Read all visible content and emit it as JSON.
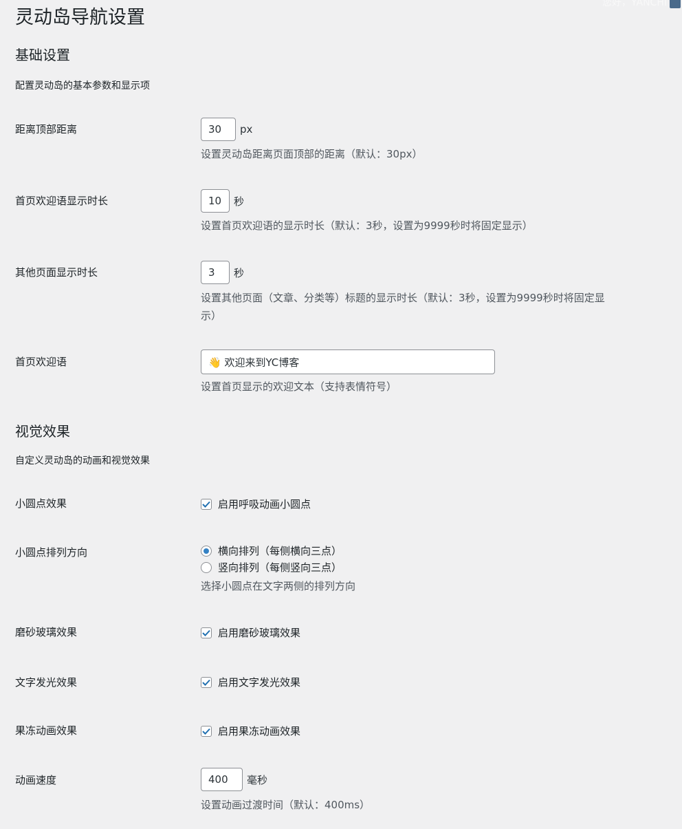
{
  "header": {
    "title": "灵动岛导航设置",
    "greeting": "您好，YANCHI"
  },
  "basic": {
    "heading": "基础设置",
    "description": "配置灵动岛的基本参数和显示项",
    "top_distance": {
      "label": "距离顶部距离",
      "value": "30",
      "unit": "px",
      "help": "设置灵动岛距离页面顶部的距离（默认：30px）"
    },
    "home_duration": {
      "label": "首页欢迎语显示时长",
      "value": "10",
      "unit": "秒",
      "help": "设置首页欢迎语的显示时长（默认：3秒，设置为9999秒时将固定显示）"
    },
    "other_duration": {
      "label": "其他页面显示时长",
      "value": "3",
      "unit": "秒",
      "help_line1": "设置其他页面（文章、分类等）标题的显示时长（默认：3秒，设置为9999秒时将固定显",
      "help_line2": "示）"
    },
    "welcome": {
      "label": "首页欢迎语",
      "value": "👋 欢迎来到YC博客",
      "help": "设置首页显示的欢迎文本（支持表情符号）"
    }
  },
  "visual": {
    "heading": "视觉效果",
    "description": "自定义灵动岛的动画和视觉效果",
    "dots": {
      "label": "小圆点效果",
      "checkbox_label": "启用呼吸动画小圆点",
      "checked": true
    },
    "dots_direction": {
      "label": "小圆点排列方向",
      "options": [
        "横向排列（每侧横向三点）",
        "竖向排列（每侧竖向三点）"
      ],
      "selected": 0,
      "help": "选择小圆点在文字两侧的排列方向"
    },
    "frosted": {
      "label": "磨砂玻璃效果",
      "checkbox_label": "启用磨砂玻璃效果",
      "checked": true
    },
    "glow": {
      "label": "文字发光效果",
      "checkbox_label": "启用文字发光效果",
      "checked": true
    },
    "jelly": {
      "label": "果冻动画效果",
      "checkbox_label": "启用果冻动画效果",
      "checked": true
    },
    "speed": {
      "label": "动画速度",
      "value": "400",
      "unit": "毫秒",
      "help": "设置动画过渡时间（默认：400ms）"
    }
  },
  "colors": {
    "accent": "#2271b1",
    "check": "#3582c4"
  }
}
